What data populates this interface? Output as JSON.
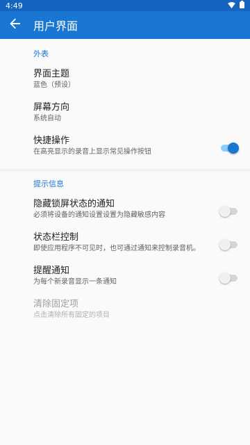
{
  "status_bar": {
    "time": "4:49",
    "icons": [
      "wifi-icon",
      "battery-icon"
    ]
  },
  "app_bar": {
    "back_icon": "arrow-back-icon",
    "title": "用户界面"
  },
  "sections": [
    {
      "header": "外表",
      "items": [
        {
          "title": "界面主题",
          "subtitle": "蓝色（预设）"
        },
        {
          "title": "屏幕方向",
          "subtitle": "系统自动"
        },
        {
          "title": "快捷操作",
          "subtitle": "在高亮显示的录音上显示常见操作按钮",
          "toggle": true,
          "checked": true
        }
      ]
    },
    {
      "header": "提示信息",
      "items": [
        {
          "title": "隐藏锁屏状态的通知",
          "subtitle": "必须将设备的通知设置设置为隐藏敏感内容",
          "toggle": true,
          "checked": false
        },
        {
          "title": "状态栏控制",
          "subtitle": "即使应用程序不可见时，也可通过通知来控制录音机。",
          "toggle": true,
          "checked": false
        },
        {
          "title": "提醒通知",
          "subtitle": "为每个新录音显示一条通知",
          "toggle": true,
          "checked": false
        },
        {
          "title": "清除固定项",
          "subtitle": "点击清除所有固定的项目",
          "disabled": true
        }
      ]
    }
  ],
  "colors": {
    "status_bar": "#1565c0",
    "app_bar": "#1976d2",
    "accent": "#1976d2"
  }
}
